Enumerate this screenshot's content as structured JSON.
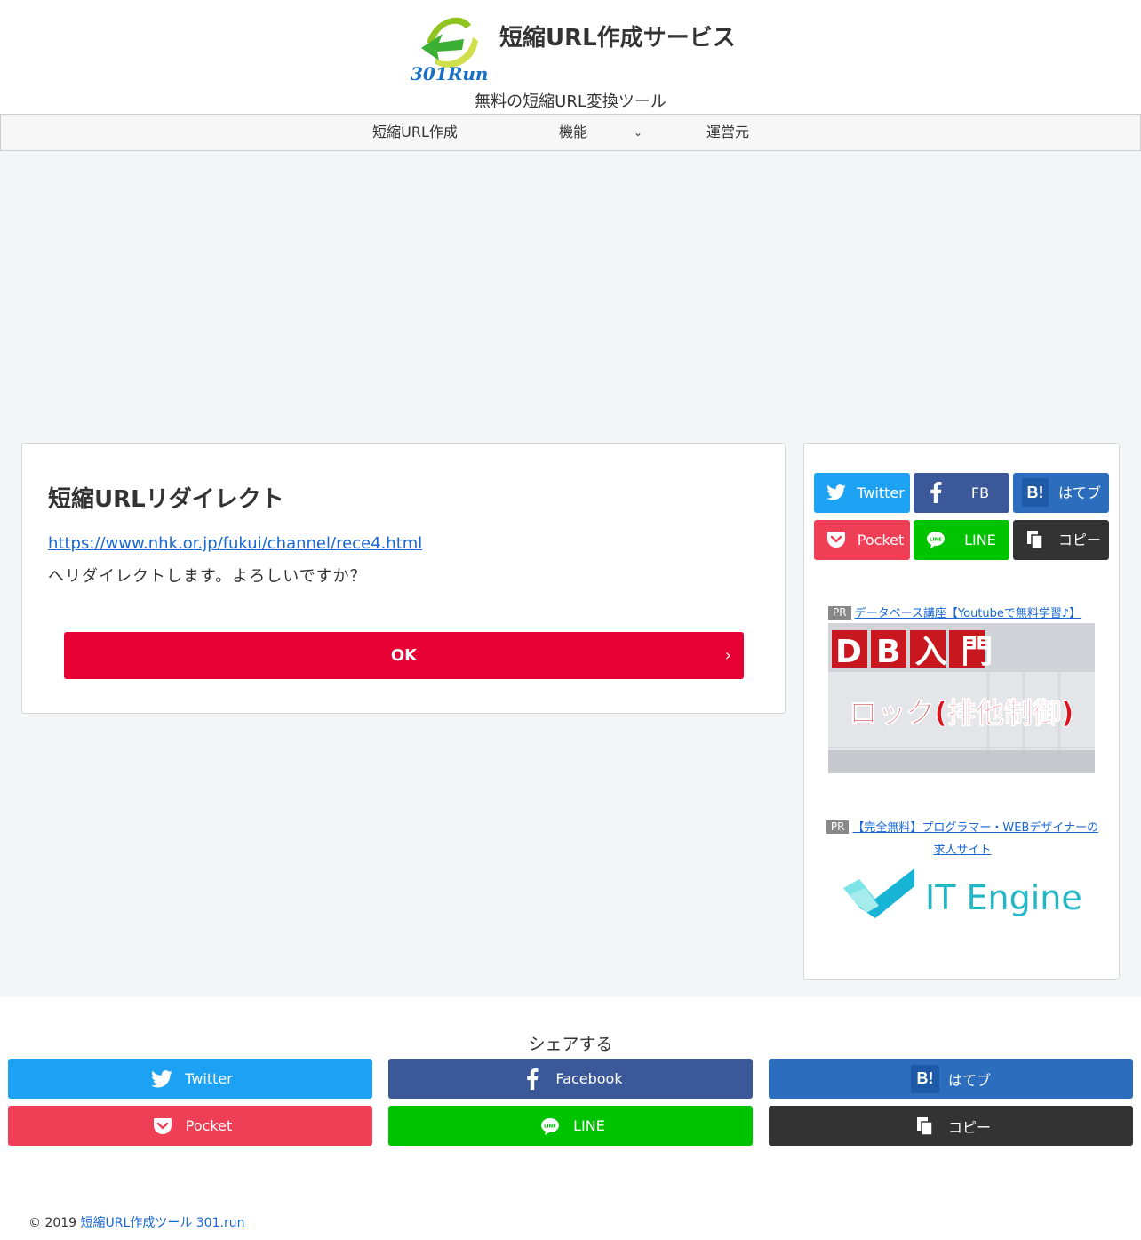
{
  "header": {
    "site_title": "短縮URL作成サービス",
    "tagline": "無料の短縮URL変換ツール",
    "logo_text": "301Run"
  },
  "nav": {
    "items": [
      {
        "label": "短縮URL作成"
      },
      {
        "label": "機能"
      },
      {
        "label": "運営元"
      }
    ]
  },
  "card": {
    "title": "短縮URLリダイレクト",
    "target_url": "https://www.nhk.or.jp/fukui/channel/rece4.html",
    "message": "へリダイレクトします。よろしいですか？",
    "ok_label": "OK"
  },
  "sidebar": {
    "share": [
      {
        "label": "Twitter",
        "icon": "twitter-icon",
        "color": "#1da1f2"
      },
      {
        "label": "FB",
        "icon": "facebook-icon",
        "color": "#3b5998"
      },
      {
        "label": "はてブ",
        "icon": "hatena-icon",
        "color": "#2c6ebd"
      },
      {
        "label": "Pocket",
        "icon": "pocket-icon",
        "color": "#ef3f56"
      },
      {
        "label": "LINE",
        "icon": "line-icon",
        "color": "#00c300"
      },
      {
        "label": "コピー",
        "icon": "copy-icon",
        "color": "#333333"
      }
    ],
    "ad1": {
      "tag": "PR",
      "link_text": "データベース講座【Youtubeで無料学習♪】",
      "banner_line1": "DB入門",
      "banner_line2": "ロック(排他制御)"
    },
    "ad2": {
      "tag": "PR",
      "link_text_line1": "【完全無料】プログラマー・WEBデザイナーの",
      "link_text_line2": "求人サイト",
      "logo_text": "IT Engine"
    }
  },
  "footer": {
    "share_title": "シェアする",
    "share": [
      {
        "label": "Twitter",
        "icon": "twitter-icon",
        "color": "#1da1f2"
      },
      {
        "label": "Facebook",
        "icon": "facebook-icon",
        "color": "#3b5998"
      },
      {
        "label": "はてブ",
        "icon": "hatena-icon",
        "color": "#2c6ebd"
      },
      {
        "label": "Pocket",
        "icon": "pocket-icon",
        "color": "#ef3f56"
      },
      {
        "label": "LINE",
        "icon": "line-icon",
        "color": "#00c300"
      },
      {
        "label": "コピー",
        "icon": "copy-icon",
        "color": "#333333"
      }
    ],
    "copyright_prefix": "© 2019",
    "copyright_link": "短縮URL作成ツール 301.run"
  }
}
